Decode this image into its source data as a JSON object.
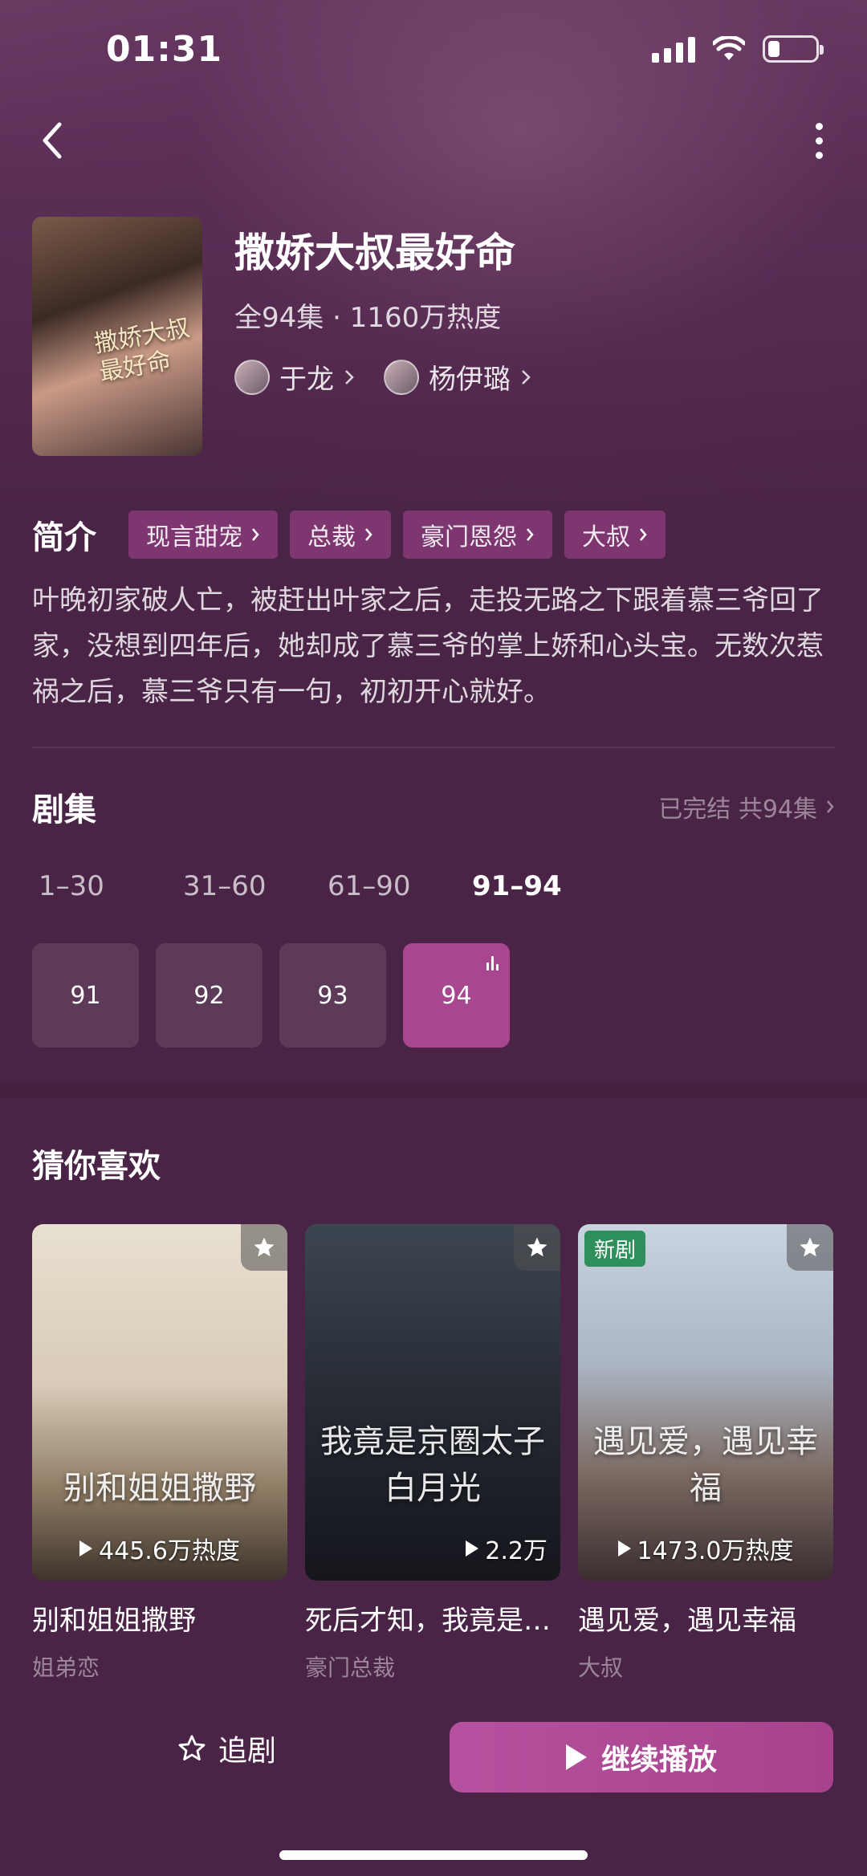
{
  "status_bar": {
    "time": "01:31"
  },
  "drama": {
    "title": "撒娇大叔最好命",
    "meta": "全94集 · 1160万热度",
    "poster_text": "撒娇大叔最好命",
    "cast": [
      {
        "name": "于龙"
      },
      {
        "name": "杨伊璐"
      }
    ]
  },
  "intro": {
    "label": "简介",
    "tags": [
      "现言甜宠",
      "总裁",
      "豪门恩怨",
      "大叔"
    ],
    "text": "叶晚初家破人亡，被赶出叶家之后，走投无路之下跟着慕三爷回了家，没想到四年后，她却成了慕三爷的掌上娇和心头宝。无数次惹祸之后，慕三爷只有一句，初初开心就好。"
  },
  "episodes": {
    "title": "剧集",
    "status": "已完结 共94集",
    "ranges": [
      "1–30",
      "31–60",
      "61–90",
      "91–94"
    ],
    "active_range": "91–94",
    "items": [
      "91",
      "92",
      "93",
      "94"
    ],
    "playing": "94"
  },
  "recommend": {
    "title": "猜你喜欢",
    "cards": [
      {
        "name": "别和姐姐撒野",
        "genre": "姐弟恋",
        "heat": "445.6万热度",
        "overlay": "别和姐姐撒野",
        "badge": ""
      },
      {
        "name": "死后才知，我竟是…",
        "genre": "豪门总裁",
        "heat": "2.2万",
        "overlay": "我竟是京圈太子白月光",
        "badge": ""
      },
      {
        "name": "遇见爱，遇见幸福",
        "genre": "大叔",
        "heat": "1473.0万热度",
        "overlay": "遇见爱，遇见幸福",
        "badge": "新剧"
      }
    ]
  },
  "actions": {
    "follow": "追剧",
    "continue": "继续播放"
  }
}
